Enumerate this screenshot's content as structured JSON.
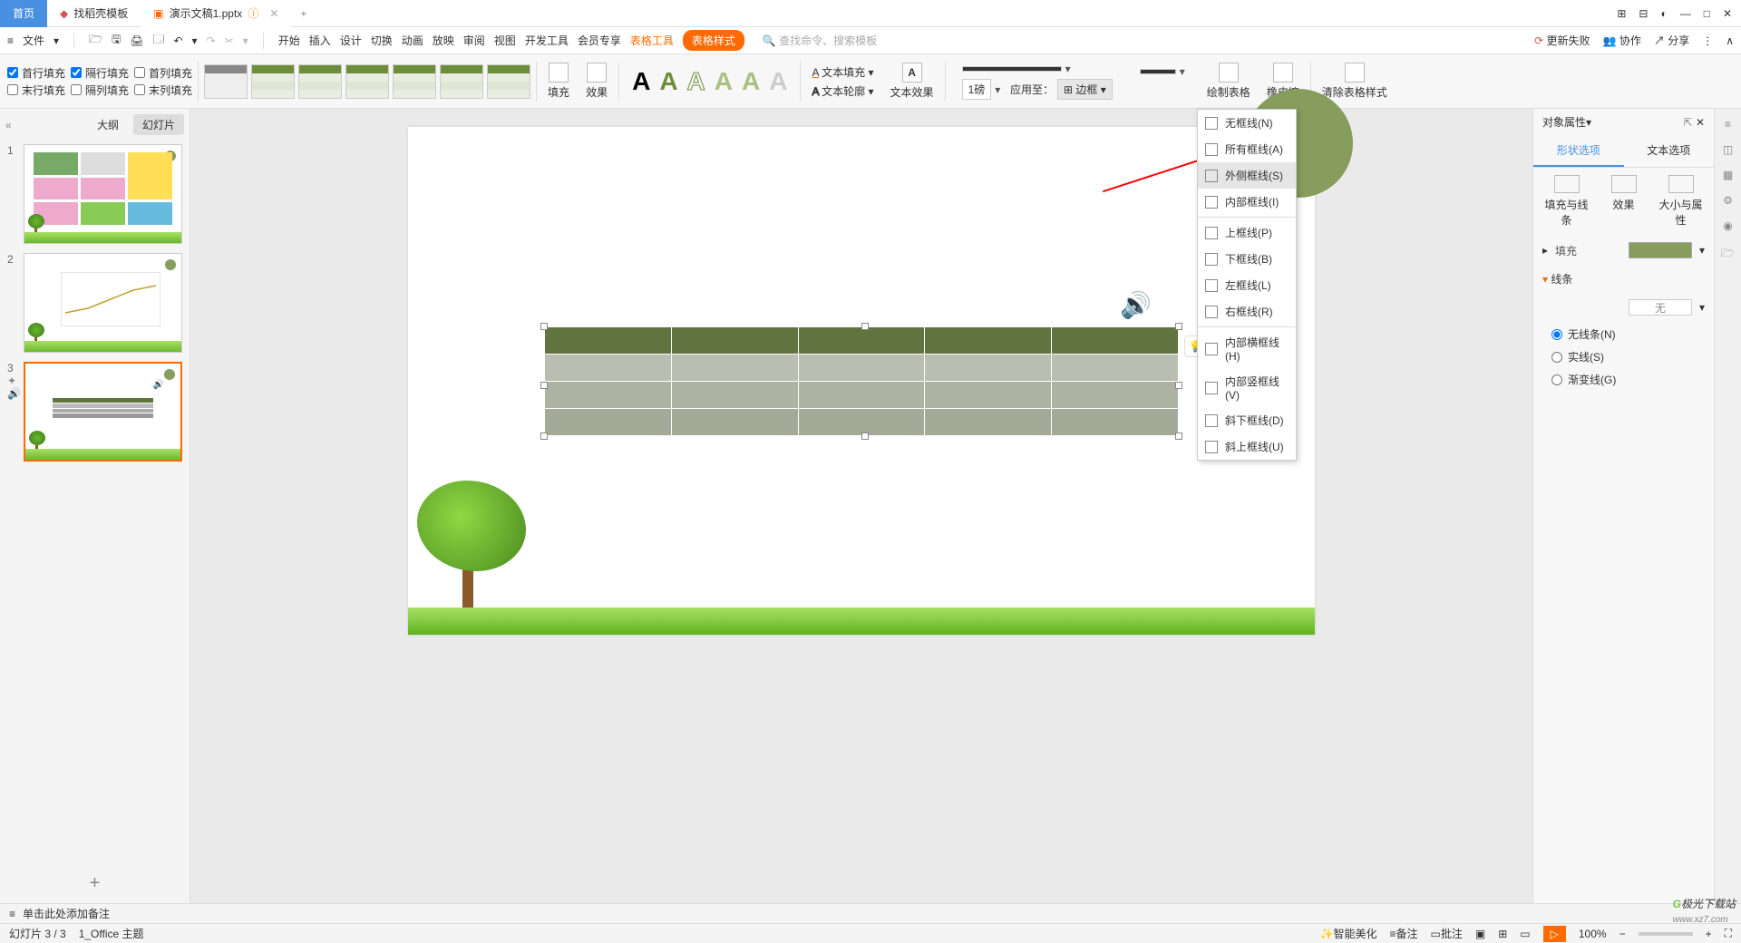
{
  "tabs": {
    "home": "首页",
    "template": "找稻壳模板",
    "doc": "演示文稿1.pptx"
  },
  "win": {
    "layout": "⊞",
    "grid": "⊟",
    "avatar": "◐",
    "min": "—",
    "max": "□",
    "close": "✕"
  },
  "menu": {
    "file": "文件",
    "items": [
      "开始",
      "插入",
      "设计",
      "切换",
      "动画",
      "放映",
      "审阅",
      "视图",
      "开发工具",
      "会员专享"
    ],
    "tool": "表格工具",
    "style": "表格样式",
    "search": "🔍 查找命令、搜索模板",
    "fail": "更新失败",
    "coop": "协作",
    "share": "分享"
  },
  "ribbon": {
    "chk": [
      [
        "首行填充",
        "隔行填充",
        "首列填充"
      ],
      [
        "末行填充",
        "隔列填充",
        "末列填充"
      ]
    ],
    "chkstate": [
      [
        true,
        true,
        false
      ],
      [
        false,
        false,
        false
      ]
    ],
    "fill": "填充",
    "effect": "效果",
    "txtfill": "文本填充",
    "txtoutline": "文本轮廓",
    "txteffect": "文本效果",
    "pt": "1磅",
    "apply": "应用至：",
    "border": "边框",
    "draw": "绘制表格",
    "erase": "橡皮擦",
    "clear": "清除表格样式"
  },
  "dropdown": {
    "items": [
      "无框线(N)",
      "所有框线(A)",
      "外侧框线(S)",
      "内部框线(I)",
      "上框线(P)",
      "下框线(B)",
      "左框线(L)",
      "右框线(R)",
      "内部横框线(H)",
      "内部竖框线(V)",
      "斜下框线(D)",
      "斜上框线(U)"
    ],
    "hover": 2,
    "seps": [
      3,
      7
    ]
  },
  "left": {
    "outline": "大纲",
    "slides": "幻灯片"
  },
  "notes": "单击此处添加备注",
  "right": {
    "title": "对象属性",
    "shape": "形状选项",
    "text": "文本选项",
    "sub": [
      "填充与线条",
      "效果",
      "大小与属性"
    ],
    "fill": "填充",
    "line": "线条",
    "none": "无",
    "r1": "无线条(N)",
    "r2": "实线(S)",
    "r3": "渐变线(G)"
  },
  "status": {
    "slide": "幻灯片 3 / 3",
    "theme": "1_Office 主题",
    "smart": "智能美化",
    "note": "备注",
    "review": "批注",
    "zoom": "100%"
  },
  "watermark": {
    "a": "极光下载站",
    "b": "www.xz7.com"
  }
}
